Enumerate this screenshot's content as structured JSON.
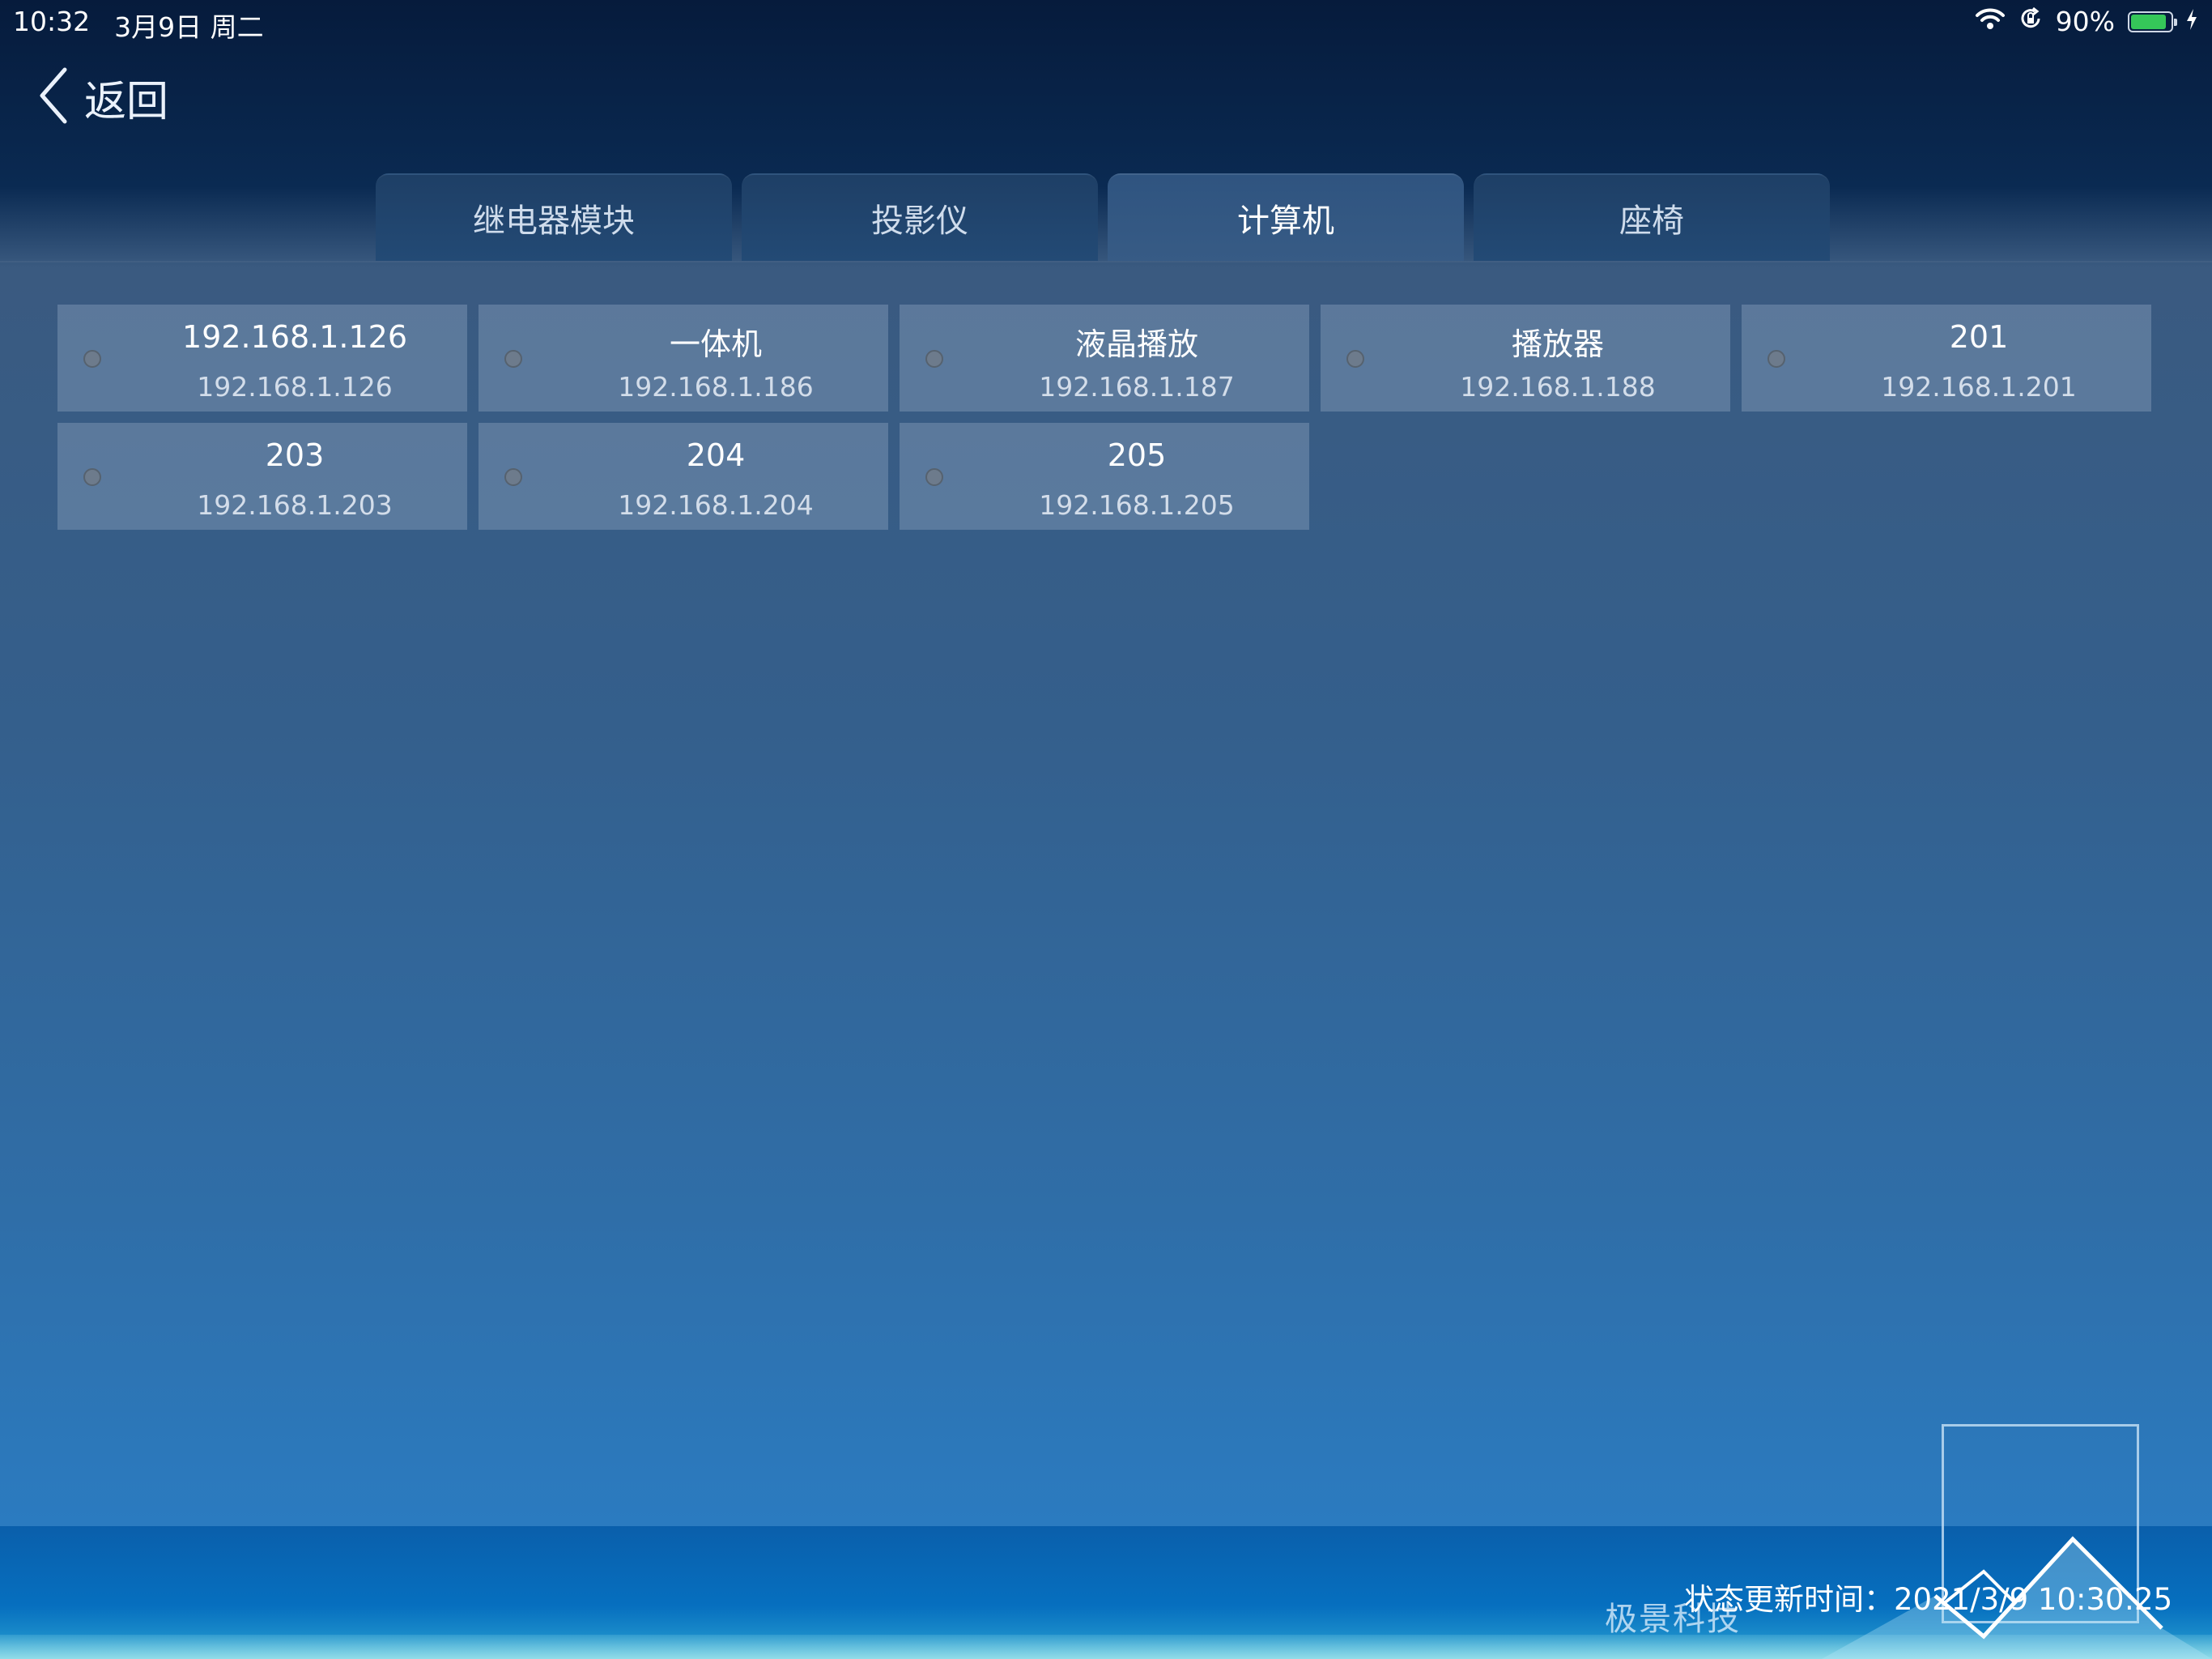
{
  "status_bar": {
    "time": "10:32",
    "date": "3月9日 周二",
    "battery_percent": "90%",
    "battery_level": 0.9
  },
  "back": {
    "label": "返回"
  },
  "tabs": [
    {
      "label": "继电器模块",
      "active": false
    },
    {
      "label": "投影仪",
      "active": false
    },
    {
      "label": "计算机",
      "active": true
    },
    {
      "label": "座椅",
      "active": false
    }
  ],
  "devices": [
    {
      "name": "192.168.1.126",
      "ip": "192.168.1.126"
    },
    {
      "name": "一体机",
      "ip": "192.168.1.186"
    },
    {
      "name": "液晶播放",
      "ip": "192.168.1.187"
    },
    {
      "name": "播放器",
      "ip": "192.168.1.188"
    },
    {
      "name": "201",
      "ip": "192.168.1.201"
    },
    {
      "name": "203",
      "ip": "192.168.1.203"
    },
    {
      "name": "204",
      "ip": "192.168.1.204"
    },
    {
      "name": "205",
      "ip": "192.168.1.205"
    }
  ],
  "footer": {
    "brand": "极景科技",
    "update_time": "状态更新时间：2021/3/9 10:30:25"
  },
  "colors": {
    "battery": "#35c759",
    "device_status_dot": "#6d7b8c"
  }
}
